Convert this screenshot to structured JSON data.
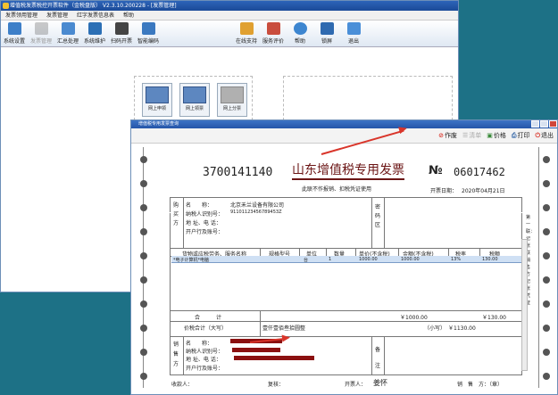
{
  "window_title": "增值税发票税控开票软件（金税盘版） V2.3.10.200228 - [发票管理]",
  "menu": [
    "发票领用管理",
    "发票管理",
    "红字发票信息表",
    "帮助"
  ],
  "toolbar": [
    "系统设置",
    "发票管理",
    "汇总处理",
    "系统维护",
    "扫码开票",
    "智能编码",
    "在线支持",
    "服务评价",
    "帮助",
    "锁屏",
    "退出"
  ],
  "modules": [
    "网上申领",
    "网上领票",
    "网上分票"
  ],
  "dialog": {
    "title": "增值税专用发票查询",
    "actions": [
      "作废",
      "清单",
      "价格",
      "打印",
      "退出"
    ]
  },
  "invoice": {
    "code": "3700141140",
    "title": "山东增值税专用发票",
    "subtitle": "此联不作报销、扣税凭证使用",
    "no_label": "№",
    "number": "06017462",
    "date_label": "开票日期：",
    "date": "2020年04月21日",
    "buyer_side": [
      "购",
      "买",
      "方"
    ],
    "buyer_labels": [
      "名　　称：",
      "纳税人识别号：",
      "地 址、电 话：",
      "开户行及账号："
    ],
    "buyer_name": "北京禾兰设备有限公司",
    "buyer_taxid": "91101123456789453Z",
    "pwd_side": [
      "密",
      "码",
      "区"
    ],
    "columns": [
      "货物或应税劳务、服务名称",
      "规格型号",
      "单位",
      "数量",
      "单价(不含税)",
      "金额(不含税)",
      "税率",
      "税额"
    ],
    "row": [
      "*电子计算机*电脑",
      "",
      "台",
      "1",
      "1000.00",
      "1000.00",
      "13%",
      "130.00"
    ],
    "total_label": "合　　　计",
    "total_amount": "￥1000.00",
    "total_tax": "￥130.00",
    "grand_label": "价税合计（大写）",
    "grand_words": "壹仟壹佰叁拾圆整",
    "grand_small_label": "（小写）",
    "grand_small": "￥1130.00",
    "seller_side": [
      "销",
      "售",
      "方"
    ],
    "seller_labels": [
      "名　　称：",
      "纳税人识别号：",
      "地 址、电 话：",
      "开户行及账号："
    ],
    "remark_side": [
      "备",
      "注"
    ],
    "payee_label": "收款人：",
    "review_label": "复核：",
    "drawer_label": "开票人：",
    "drawer": "姜怀",
    "seller_stamp": "销　售　方：（章）",
    "side_note": "第一联：记账联　销售方记账凭证"
  },
  "colors": {
    "accent": "#d9352a",
    "redaction": "#8b1010"
  }
}
